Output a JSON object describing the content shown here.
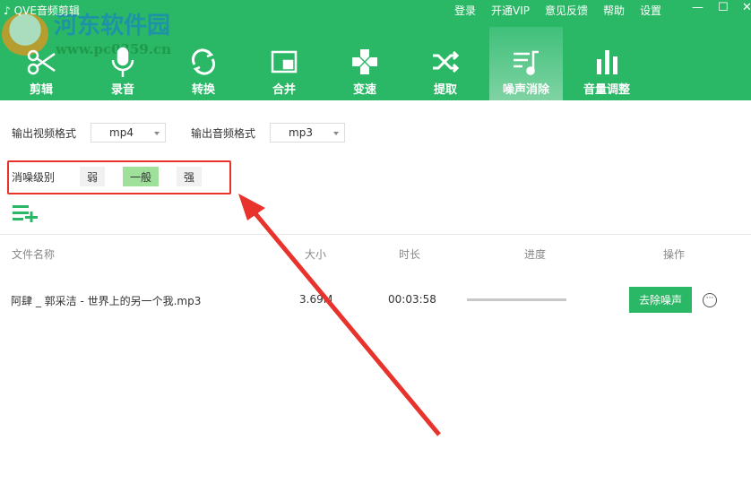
{
  "app": {
    "title": "QVE音频剪辑",
    "watermark": "河东软件园",
    "watermark_url": "www.pc0359.cn"
  },
  "topmenu": [
    "登录",
    "开通VIP",
    "意见反馈",
    "帮助",
    "设置"
  ],
  "nav": [
    {
      "label": "剪辑",
      "icon": "scissors-icon"
    },
    {
      "label": "录音",
      "icon": "microphone-icon"
    },
    {
      "label": "转换",
      "icon": "refresh-icon"
    },
    {
      "label": "合并",
      "icon": "merge-icon"
    },
    {
      "label": "变速",
      "icon": "speed-icon"
    },
    {
      "label": "提取",
      "icon": "shuffle-icon"
    },
    {
      "label": "噪声消除",
      "icon": "music-list-icon",
      "active": true
    },
    {
      "label": "音量调整",
      "icon": "bar-chart-icon"
    }
  ],
  "settings": {
    "video_format_label": "输出视频格式",
    "video_format": "mp4",
    "audio_format_label": "输出音频格式",
    "audio_format": "mp3",
    "noise_level_label": "消噪级别",
    "levels": [
      "弱",
      "一般",
      "强"
    ],
    "selected_level": "一般"
  },
  "table": {
    "headers": [
      "文件名称",
      "大小",
      "时长",
      "进度",
      "操作"
    ],
    "rows": [
      {
        "name": "阿肆 _ 郭采洁 - 世界上的另一个我.mp3",
        "size": "3.69M",
        "duration": "00:03:58",
        "progress": 0,
        "action": "去除噪声"
      }
    ]
  },
  "colors": {
    "brand": "#2bb866",
    "annotation": "#e8322c"
  }
}
